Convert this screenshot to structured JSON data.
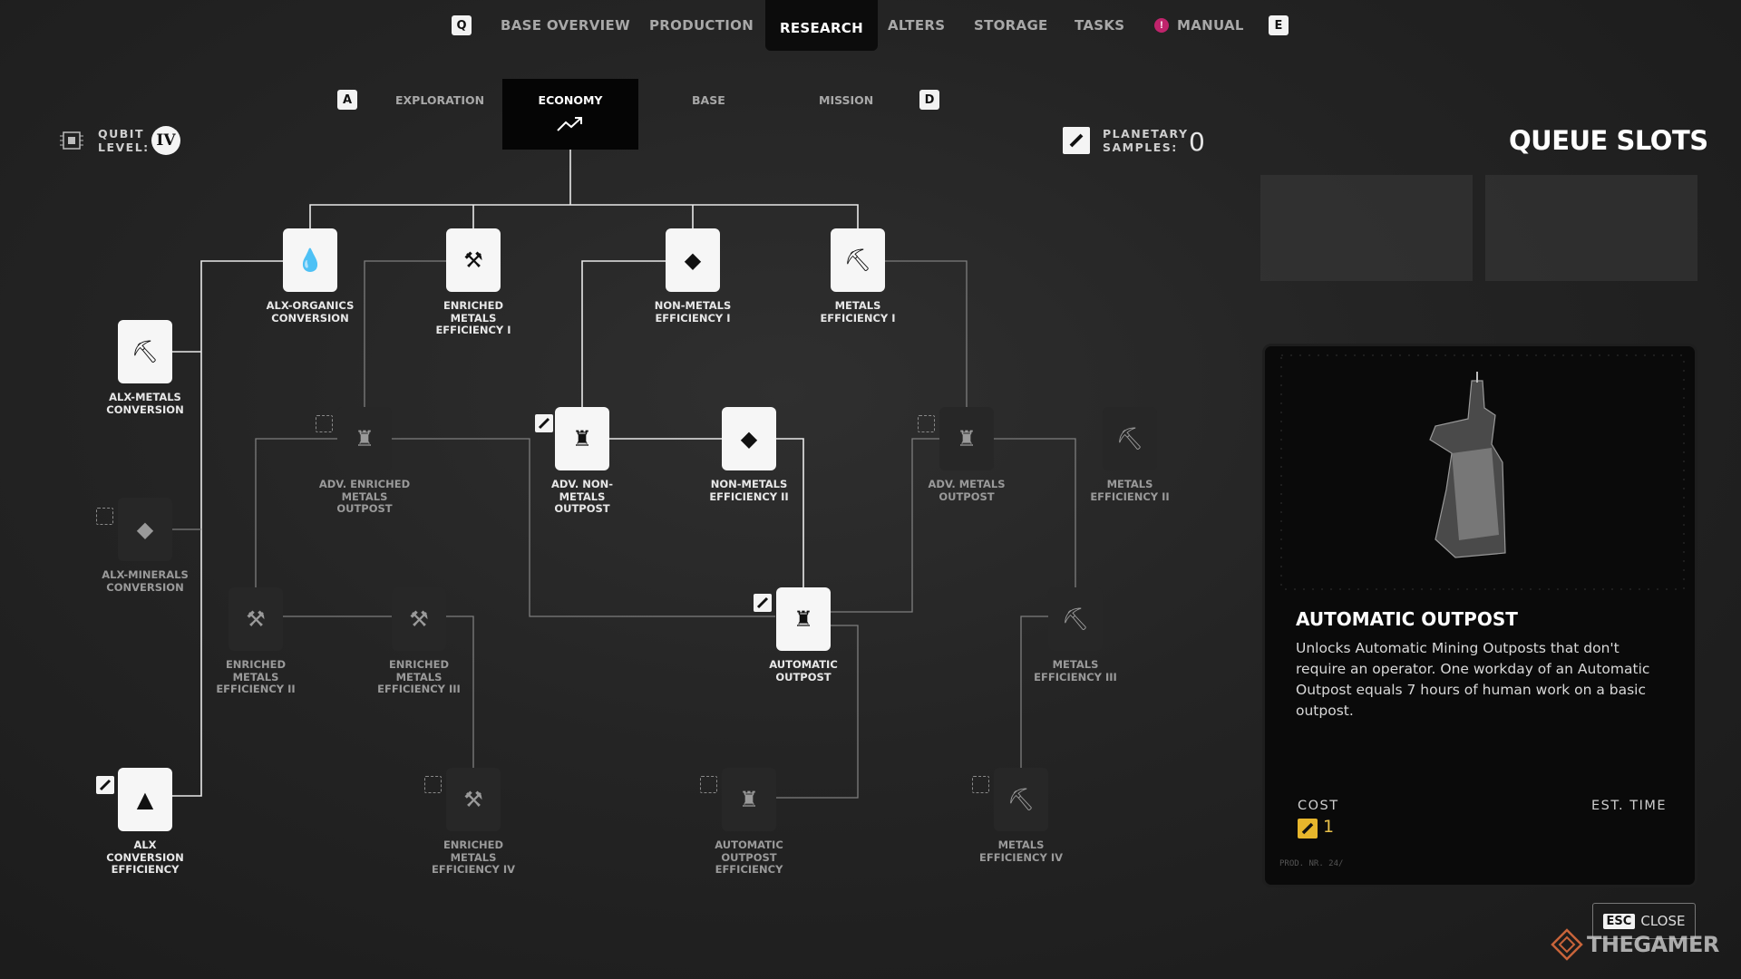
{
  "top_nav": {
    "key_left": "Q",
    "key_right": "E",
    "tabs": [
      "BASE OVERVIEW",
      "PRODUCTION",
      "RESEARCH",
      "ALTERS",
      "STORAGE",
      "TASKS",
      "MANUAL"
    ],
    "active_tab": "RESEARCH",
    "manual_badge": "!"
  },
  "sub_nav": {
    "key_left": "A",
    "key_right": "D",
    "tabs": [
      "EXPLORATION",
      "ECONOMY",
      "BASE",
      "MISSION"
    ],
    "active_tab": "ECONOMY"
  },
  "qubit": {
    "label": "QUBIT\nLEVEL:",
    "level": "IV"
  },
  "planetary": {
    "label": "PLANETARY\nSAMPLES:",
    "value": "0"
  },
  "queue": {
    "title": "QUEUE SLOTS",
    "slot_count": 2
  },
  "tree": {
    "nodes": [
      {
        "id": "alx-organics",
        "label": "ALX-ORGANICS\nCONVERSION",
        "state": "unlocked",
        "glyph": "💧"
      },
      {
        "id": "enriched-1",
        "label": "ENRICHED\nMETALS\nEFFICIENCY I",
        "state": "unlocked",
        "glyph": "⚒"
      },
      {
        "id": "nonmetals-1",
        "label": "NON-METALS\nEFFICIENCY I",
        "state": "unlocked",
        "glyph": "◆"
      },
      {
        "id": "metals-1",
        "label": "METALS\nEFFICIENCY I",
        "state": "unlocked",
        "glyph": "⛏"
      },
      {
        "id": "alx-metals",
        "label": "ALX-METALS\nCONVERSION",
        "state": "unlocked",
        "glyph": "⛏"
      },
      {
        "id": "adv-enriched-outpost",
        "label": "ADV. ENRICHED\nMETALS\nOUTPOST",
        "state": "locked",
        "glyph": "♜"
      },
      {
        "id": "adv-nonmetals-outpost",
        "label": "ADV. NON-\nMETALS\nOUTPOST",
        "state": "unlocked",
        "glyph": "♜"
      },
      {
        "id": "nonmetals-2",
        "label": "NON-METALS\nEFFICIENCY II",
        "state": "unlocked",
        "glyph": "◆"
      },
      {
        "id": "adv-metals-outpost",
        "label": "ADV. METALS\nOUTPOST",
        "state": "locked",
        "glyph": "♜"
      },
      {
        "id": "metals-2",
        "label": "METALS\nEFFICIENCY II",
        "state": "locked",
        "glyph": "⛏"
      },
      {
        "id": "alx-minerals",
        "label": "ALX-MINERALS\nCONVERSION",
        "state": "locked",
        "glyph": "◆"
      },
      {
        "id": "enriched-2",
        "label": "ENRICHED\nMETALS\nEFFICIENCY II",
        "state": "locked",
        "glyph": "⚒"
      },
      {
        "id": "enriched-3",
        "label": "ENRICHED\nMETALS\nEFFICIENCY III",
        "state": "locked",
        "glyph": "⚒"
      },
      {
        "id": "automatic-outpost",
        "label": "AUTOMATIC\nOUTPOST",
        "state": "unlocked",
        "glyph": "♜"
      },
      {
        "id": "metals-3",
        "label": "METALS\nEFFICIENCY III",
        "state": "locked",
        "glyph": "⛏"
      },
      {
        "id": "alx-conversion-eff",
        "label": "ALX\nCONVERSION\nEFFICIENCY",
        "state": "unlocked",
        "glyph": "▲"
      },
      {
        "id": "enriched-4",
        "label": "ENRICHED\nMETALS\nEFFICIENCY IV",
        "state": "locked",
        "glyph": "⚒"
      },
      {
        "id": "auto-outpost-eff",
        "label": "AUTOMATIC\nOUTPOST\nEFFICIENCY",
        "state": "locked",
        "glyph": "♜"
      },
      {
        "id": "metals-4",
        "label": "METALS\nEFFICIENCY IV",
        "state": "locked",
        "glyph": "⛏"
      }
    ]
  },
  "detail": {
    "title": "AUTOMATIC OUTPOST",
    "description": "Unlocks Automatic Mining Outposts that don't require an operator. One workday of an Automatic Outpost equals 7 hours of human work on a basic outpost.",
    "cost_label": "COST",
    "cost_value": "1",
    "time_label": "EST. TIME",
    "prod_nr": "PROD. NR. 24/"
  },
  "close": {
    "key": "ESC",
    "label": "CLOSE"
  },
  "watermark": "THEGAMER",
  "colors": {
    "accent_cost": "#e7b62c",
    "manual_badge": "#c0246c"
  }
}
